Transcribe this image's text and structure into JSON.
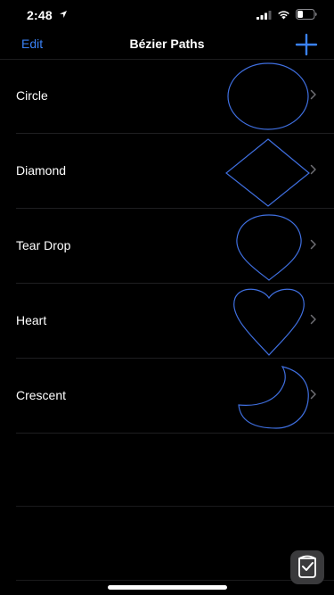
{
  "status_bar": {
    "time": "2:48",
    "location_icon": "location-arrow-icon",
    "signal_icon": "cellular-signal-icon",
    "wifi_icon": "wifi-icon",
    "battery_icon": "battery-icon"
  },
  "nav": {
    "edit_label": "Edit",
    "title": "Bézier Paths",
    "add_icon": "plus-icon",
    "accent_color": "#3a82f7"
  },
  "rows": [
    {
      "label": "Circle",
      "shape_icon": "circle-path-icon"
    },
    {
      "label": "Diamond",
      "shape_icon": "diamond-path-icon"
    },
    {
      "label": "Tear Drop",
      "shape_icon": "tear-drop-path-icon"
    },
    {
      "label": "Heart",
      "shape_icon": "heart-path-icon"
    },
    {
      "label": "Crescent",
      "shape_icon": "crescent-path-icon"
    }
  ],
  "shape_stroke_color": "#3f6fe0",
  "floating_badge_icon": "app-badge-icon"
}
